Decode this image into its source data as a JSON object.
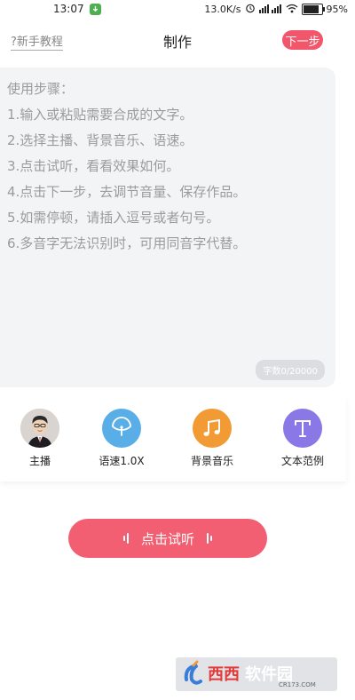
{
  "status_bar": {
    "time": "13:07",
    "net_speed": "13.0K/s",
    "battery": "95%"
  },
  "header": {
    "help_link": "?新手教程",
    "title": "制作",
    "next_label": "下一步"
  },
  "editor": {
    "instructions": [
      "使用步骤：",
      "1.输入或粘贴需要合成的文字。",
      "2.选择主播、背景音乐、语速。",
      "3.点击试听，看看效果如何。",
      "4.点击下一步，去调节音量、保存作品。",
      "5.如需停顿，请插入逗号或者句号。",
      "6.多音字无法识别时，可用同音字代替。"
    ],
    "char_count": "字数0/20000"
  },
  "options": [
    {
      "label": "主播",
      "icon": "anchor-avatar-icon"
    },
    {
      "label": "语速1.0X",
      "icon": "speedometer-icon"
    },
    {
      "label": "背景音乐",
      "icon": "music-note-icon"
    },
    {
      "label": "文本范例",
      "icon": "text-t-icon"
    }
  ],
  "play_button": {
    "label": "点击试听"
  },
  "watermark": {
    "text": "西西软件园",
    "sub": "CR173.COM"
  },
  "colors": {
    "accent": "#f2566b",
    "play": "#f35f72",
    "speed": "#5aaee8",
    "music": "#f29a33",
    "text_sample": "#8a78e6"
  }
}
